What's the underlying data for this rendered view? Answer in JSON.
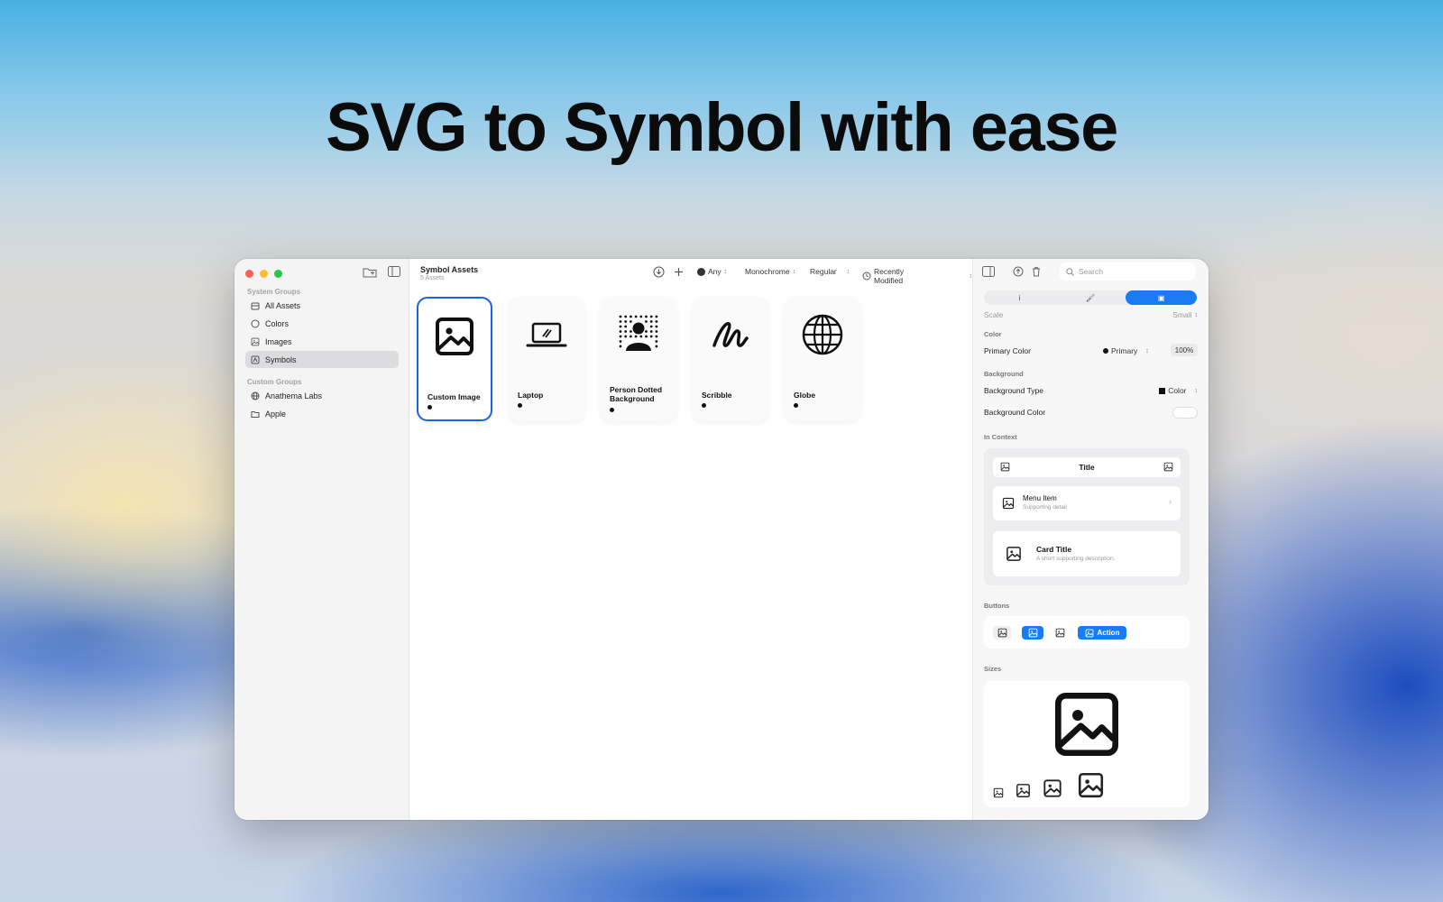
{
  "headline": "SVG to Symbol with ease",
  "sidebar": {
    "system_groups_label": "System Groups",
    "items": [
      {
        "label": "All Assets",
        "icon": "tray-icon"
      },
      {
        "label": "Colors",
        "icon": "circle-icon"
      },
      {
        "label": "Images",
        "icon": "photo-icon"
      },
      {
        "label": "Symbols",
        "icon": "symbol-icon",
        "selected": true
      }
    ],
    "custom_groups_label": "Custom Groups",
    "custom_items": [
      {
        "label": "Anathema Labs",
        "icon": "globe-icon"
      },
      {
        "label": "Apple",
        "icon": "folder-icon"
      }
    ]
  },
  "main": {
    "title": "Symbol Assets",
    "subtitle": "5 Assets",
    "toolbar": {
      "rendering_any": "Any",
      "mode": "Monochrome",
      "weight": "Regular",
      "sort": "Recently Modified"
    },
    "cards": [
      {
        "name": "Custom Image",
        "glyph": "photo-icon",
        "selected": true
      },
      {
        "name": "Laptop",
        "glyph": "laptop-icon"
      },
      {
        "name": "Person Dotted Background",
        "glyph": "person-dotted-icon"
      },
      {
        "name": "Scribble",
        "glyph": "scribble-icon"
      },
      {
        "name": "Globe",
        "glyph": "globe-icon"
      }
    ]
  },
  "inspector": {
    "search_placeholder": "Search",
    "tabs": [
      "i",
      "",
      ""
    ],
    "scale_label": "Scale",
    "scale_value": "Small",
    "color_section": "Color",
    "primary_color_label": "Primary Color",
    "primary_color_value": "Primary",
    "opacity": "100%",
    "background_section": "Background",
    "background_type_label": "Background Type",
    "background_type_value": "Color",
    "background_color_label": "Background Color",
    "in_context_section": "In Context",
    "ctx_title": "Title",
    "ctx_menu_item": "Menu Item",
    "ctx_menu_detail": "Supporting detail",
    "ctx_card_title": "Card Title",
    "ctx_card_desc": "A short supporting description.",
    "buttons_section": "Buttons",
    "action_label": "Action",
    "sizes_section": "Sizes"
  },
  "colors": {
    "accent": "#1a7cf5",
    "selection_border": "#1d62e5"
  }
}
